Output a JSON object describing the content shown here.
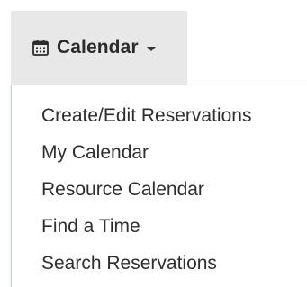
{
  "nav": {
    "icon": "calendar-icon",
    "label": "Calendar",
    "caret_icon": "caret-down-icon",
    "active_background": "#e8e8e8"
  },
  "menu": {
    "items": [
      {
        "label": "Create/Edit Reservations"
      },
      {
        "label": "My Calendar"
      },
      {
        "label": "Resource Calendar"
      },
      {
        "label": "Find a Time"
      },
      {
        "label": "Search Reservations"
      }
    ]
  }
}
